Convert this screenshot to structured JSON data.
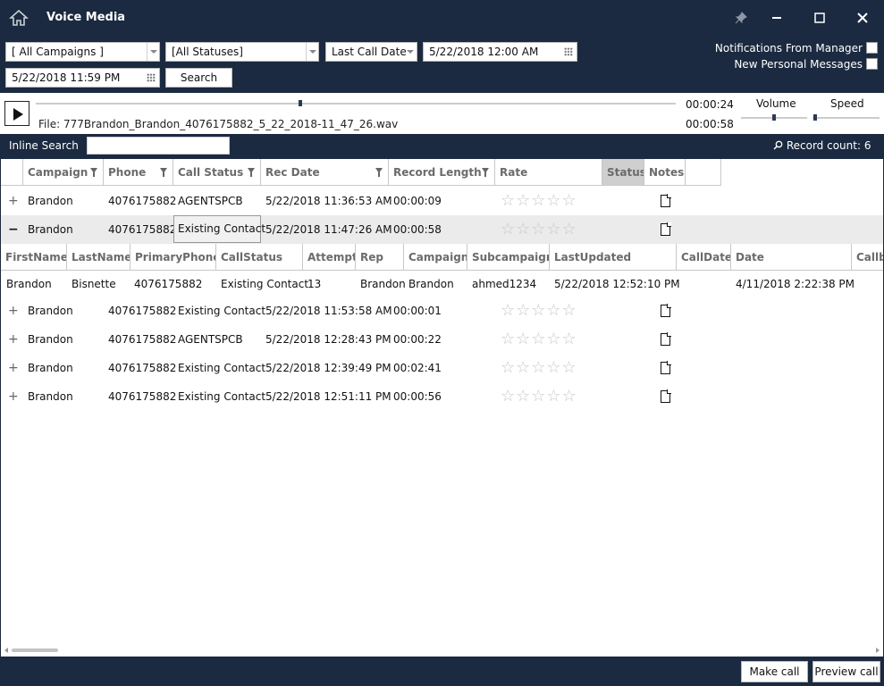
{
  "app": {
    "title": "Voice Media"
  },
  "filters": {
    "campaign": "[ All Campaigns ]",
    "status": "[All Statuses]",
    "date_field": "Last Call Date",
    "date_from": "5/22/2018 12:00 AM",
    "date_to": "5/22/2018 11:59 PM",
    "search_label": "Search"
  },
  "notifications": {
    "manager_label": "Notifications From Manager",
    "personal_label": "New Personal Messages"
  },
  "player": {
    "file_label": "File: 777Brandon_Brandon_4076175882_5_22_2018-11_47_26.wav",
    "elapsed": "00:00:24",
    "total": "00:00:58",
    "volume_label": "Volume",
    "speed_label": "Speed",
    "progress_fraction": 0.41
  },
  "search": {
    "label": "Inline Search",
    "record_count": "Record count: 6"
  },
  "grid": {
    "columns": [
      "Campaign",
      "Phone",
      "Call Status",
      "Rec Date",
      "Record Length",
      "Rate",
      "Status",
      "Notes"
    ],
    "rows": [
      {
        "expander": "+",
        "campaign": "Brandon",
        "phone": "4076175882",
        "call_status": "AGENTSPCB",
        "rec_date": "5/22/2018 11:36:53 AM",
        "length": "00:00:09"
      },
      {
        "expander": "−",
        "campaign": "Brandon",
        "phone": "4076175882",
        "call_status": "Existing Contact",
        "rec_date": "5/22/2018 11:47:26 AM",
        "length": "00:00:58"
      },
      {
        "expander": "+",
        "campaign": "Brandon",
        "phone": "4076175882",
        "call_status": "Existing Contact",
        "rec_date": "5/22/2018 11:53:58 AM",
        "length": "00:00:01"
      },
      {
        "expander": "+",
        "campaign": "Brandon",
        "phone": "4076175882",
        "call_status": "AGENTSPCB",
        "rec_date": "5/22/2018 12:28:43 PM",
        "length": "00:00:22"
      },
      {
        "expander": "+",
        "campaign": "Brandon",
        "phone": "4076175882",
        "call_status": "Existing Contact",
        "rec_date": "5/22/2018 12:39:49 PM",
        "length": "00:02:41"
      },
      {
        "expander": "+",
        "campaign": "Brandon",
        "phone": "4076175882",
        "call_status": "Existing Contact",
        "rec_date": "5/22/2018 12:51:11 PM",
        "length": "00:00:56"
      }
    ],
    "stars": "☆☆☆☆☆",
    "detail": {
      "columns": [
        "FirstName",
        "LastName",
        "PrimaryPhone",
        "CallStatus",
        "Attempt",
        "Rep",
        "Campaign",
        "Subcampaign",
        "LastUpdated",
        "CallDate",
        "Date",
        "Callb"
      ],
      "row": {
        "firstname": "Brandon",
        "lastname": "Bisnette",
        "phone": "4076175882",
        "callstatus": "Existing Contact",
        "attempt": "13",
        "rep": "Brandon",
        "campaign": "Brandon",
        "subcampaign": "ahmed1234",
        "lastupdated": "5/22/2018 12:52:10 PM",
        "calldate": "",
        "date": "4/11/2018 2:22:38 PM"
      }
    }
  },
  "footer": {
    "make_call": "Make call",
    "preview_call": "Preview call"
  }
}
